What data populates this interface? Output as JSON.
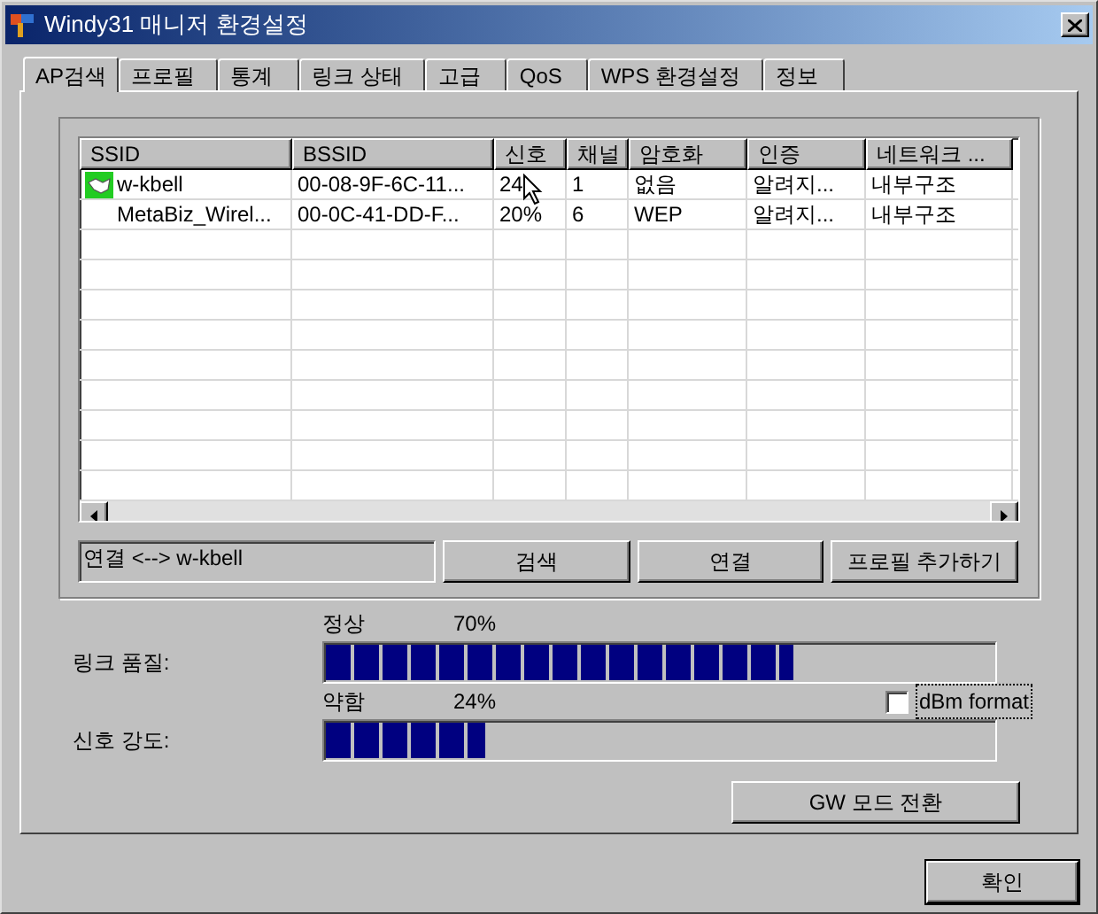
{
  "window": {
    "title": "Windy31 매니저 환경설정"
  },
  "tabs": [
    {
      "label": "AP검색",
      "selected": true
    },
    {
      "label": "프로필",
      "selected": false
    },
    {
      "label": "통계",
      "selected": false
    },
    {
      "label": "링크 상태",
      "selected": false
    },
    {
      "label": "고급",
      "selected": false
    },
    {
      "label": "QoS",
      "selected": false
    },
    {
      "label": "WPS  환경설정",
      "selected": false
    },
    {
      "label": "정보",
      "selected": false
    }
  ],
  "list": {
    "columns": [
      "SSID",
      "BSSID",
      "신호",
      "채널",
      "암호화",
      "인증",
      "네트워크 ..."
    ],
    "rows": [
      {
        "connected": true,
        "cells": [
          "w-kbell",
          "00-08-9F-6C-11...",
          "24",
          "1",
          "없음",
          "알려지...",
          "내부구조"
        ]
      },
      {
        "connected": false,
        "cells": [
          "MetaBiz_Wirel...",
          "00-0C-41-DD-F...",
          "20%",
          "6",
          "WEP",
          "알려지...",
          "내부구조"
        ]
      }
    ]
  },
  "status_field": {
    "value": "연결 <--> w-kbell"
  },
  "action_buttons": [
    "검색",
    "연결",
    "프로필 추가하기"
  ],
  "meters": [
    {
      "label": "링크 품질:",
      "status": "정상",
      "reading": "70%",
      "level": 0.7
    },
    {
      "label": "신호 강도:",
      "status": "약함",
      "reading": "24%",
      "level": 0.24
    }
  ],
  "dbm_checkbox": {
    "label": "dBm format",
    "checked": false
  },
  "gw_button": "GW 모드 전환",
  "ok_button": "확인"
}
